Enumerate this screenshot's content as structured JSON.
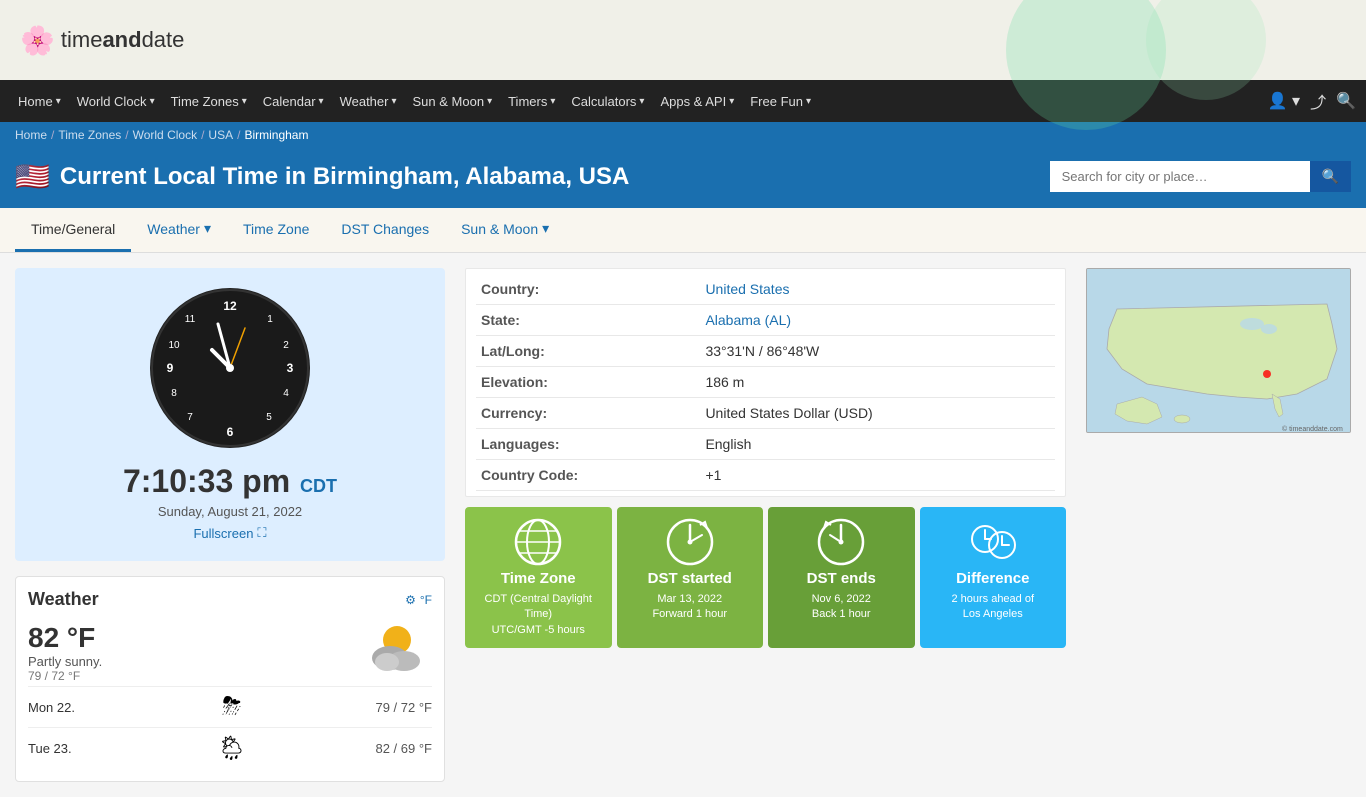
{
  "logo": {
    "icon": "🌸",
    "text_before": "time",
    "text_bold": "and",
    "text_after": "date"
  },
  "nav": {
    "items": [
      {
        "label": "Home",
        "has_arrow": true
      },
      {
        "label": "World Clock",
        "has_arrow": true
      },
      {
        "label": "Time Zones",
        "has_arrow": true
      },
      {
        "label": "Calendar",
        "has_arrow": true
      },
      {
        "label": "Weather",
        "has_arrow": true
      },
      {
        "label": "Sun & Moon",
        "has_arrow": true
      },
      {
        "label": "Timers",
        "has_arrow": true
      },
      {
        "label": "Calculators",
        "has_arrow": true
      },
      {
        "label": "Apps & API",
        "has_arrow": true
      },
      {
        "label": "Free Fun",
        "has_arrow": true
      }
    ]
  },
  "breadcrumb": {
    "items": [
      "Home",
      "Time Zones",
      "World Clock",
      "USA",
      "Birmingham"
    ]
  },
  "page": {
    "title": "Current Local Time in Birmingham, Alabama, USA",
    "flag": "🇺🇸"
  },
  "search": {
    "placeholder": "Search for city or place…"
  },
  "sub_tabs": [
    {
      "label": "Time/General",
      "active": true
    },
    {
      "label": "Weather",
      "has_arrow": true
    },
    {
      "label": "Time Zone"
    },
    {
      "label": "DST Changes"
    },
    {
      "label": "Sun & Moon",
      "has_arrow": true
    }
  ],
  "clock": {
    "time": "7:10:33 pm",
    "timezone": "CDT",
    "date": "Sunday, August 21, 2022",
    "fullscreen_label": "Fullscreen"
  },
  "location_info": {
    "rows": [
      {
        "label": "Country:",
        "value": "United States",
        "is_link": true
      },
      {
        "label": "State:",
        "value": "Alabama (AL)",
        "is_link": true
      },
      {
        "label": "Lat/Long:",
        "value": "33°31'N / 86°48'W",
        "is_link": false
      },
      {
        "label": "Elevation:",
        "value": "186 m",
        "is_link": false
      },
      {
        "label": "Currency:",
        "value": "United States Dollar (USD)",
        "is_link": false
      },
      {
        "label": "Languages:",
        "value": "English",
        "is_link": false
      },
      {
        "label": "Country Code:",
        "value": "+1",
        "is_link": false
      }
    ]
  },
  "weather": {
    "title": "Weather",
    "settings_icon": "⚙",
    "unit": "°F",
    "temp": "82 °F",
    "description": "Partly sunny.",
    "range": "79 / 72 °F",
    "icon": "⛅",
    "forecast": [
      {
        "day": "Mon 22.",
        "icon": "⛈",
        "temp": "79 / 72 °F"
      },
      {
        "day": "Tue 23.",
        "icon": "🌦",
        "temp": "82 / 69 °F"
      }
    ]
  },
  "info_boxes": [
    {
      "color": "green",
      "icon_type": "timezone",
      "title": "Time Zone",
      "sub_line1": "CDT (Central Daylight Time)",
      "sub_line2": "UTC/GMT -5 hours"
    },
    {
      "color": "green2",
      "icon_type": "dst-start",
      "title": "DST started",
      "sub_line1": "Mar 13, 2022",
      "sub_line2": "Forward 1 hour"
    },
    {
      "color": "green3",
      "icon_type": "dst-end",
      "title": "DST ends",
      "sub_line1": "Nov 6, 2022",
      "sub_line2": "Back 1 hour"
    },
    {
      "color": "blue",
      "icon_type": "difference",
      "title": "Difference",
      "sub_line1": "2 hours ahead of",
      "sub_line2": "Los Angeles"
    }
  ],
  "map": {
    "alt": "Map of USA"
  }
}
